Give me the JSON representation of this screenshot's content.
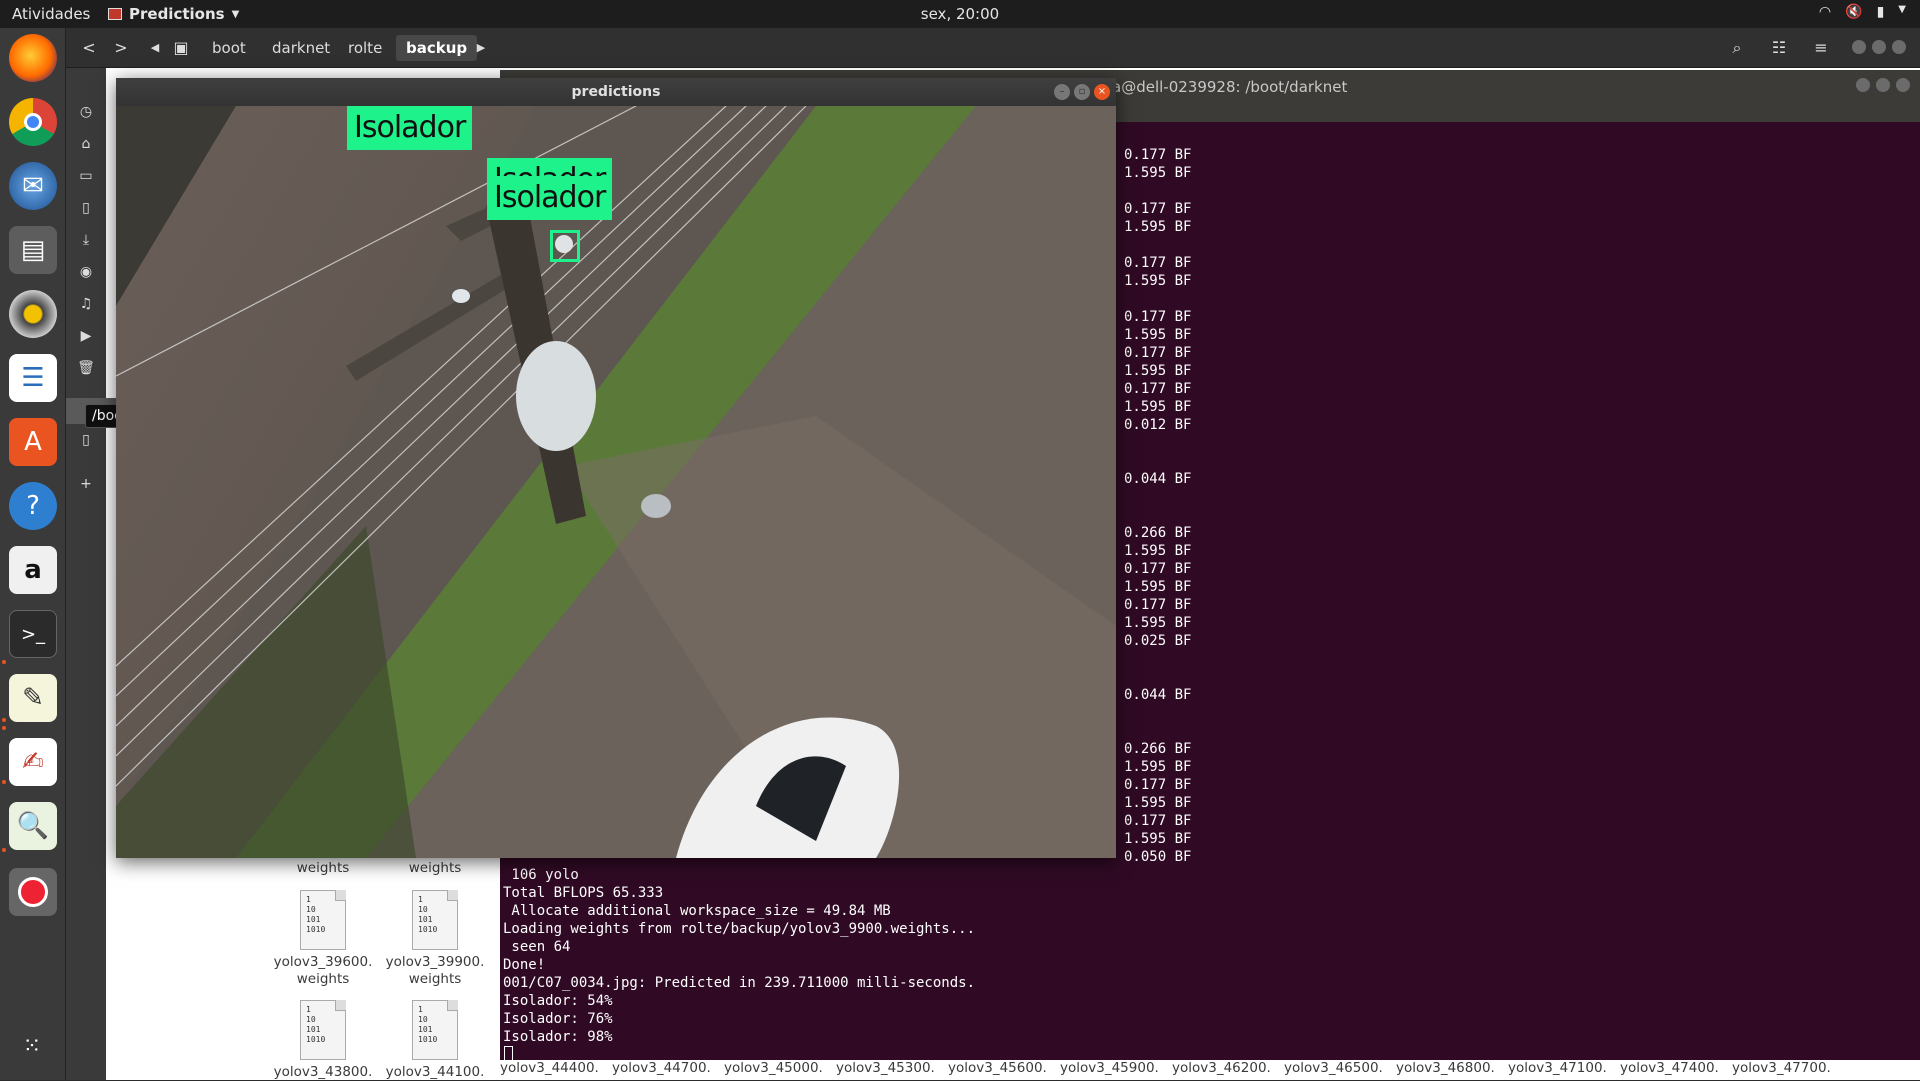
{
  "topbar": {
    "activities": "Atividades",
    "app_name": "Predictions",
    "clock": "sex, 20:00"
  },
  "dock": {
    "apps": [
      "firefox-icon",
      "chrome-icon",
      "thunderbird-icon",
      "files-icon",
      "rhythmbox-icon",
      "writer-icon",
      "software-icon",
      "help-icon",
      "amazon-icon",
      "terminal-icon",
      "gedit-icon",
      "evince-icon",
      "image-viewer-icon",
      "block-icon"
    ],
    "show_apps": "apps-grid-icon"
  },
  "files": {
    "breadcrumbs": [
      "boot",
      "darknet",
      "rolte",
      "backup"
    ],
    "active_crumb": "backup",
    "tooltip": "/boot/BBox-Label-Tool",
    "grid": [
      {
        "name1": "weights",
        "name2": ""
      },
      {
        "name1": "weights",
        "name2": ""
      },
      {
        "name1": "yolov3_39600.",
        "name2": "weights"
      },
      {
        "name1": "yolov3_39900.",
        "name2": "weights"
      },
      {
        "name1": "yolov3_43800.",
        "name2": ""
      },
      {
        "name1": "yolov3_44100.",
        "name2": ""
      }
    ],
    "doc_glyph": "1\n10\n101\n1010",
    "bottom_row": [
      "yolov3_44400.",
      "yolov3_44700.",
      "yolov3_45000.",
      "yolov3_45300.",
      "yolov3_45600.",
      "yolov3_45900.",
      "yolov3_46200.",
      "yolov3_46500.",
      "yolov3_46800.",
      "yolov3_47100.",
      "yolov3_47400.",
      "yolov3_47700."
    ]
  },
  "terminal": {
    "title": "a@dell-0239928: /boot/darknet",
    "bf_lines": "0.177 BF\n1.595 BF\n\n0.177 BF\n1.595 BF\n\n0.177 BF\n1.595 BF\n\n0.177 BF\n1.595 BF\n0.177 BF\n1.595 BF\n0.177 BF\n1.595 BF\n0.012 BF\n\n\n0.044 BF\n\n\n0.266 BF\n1.595 BF\n0.177 BF\n1.595 BF\n0.177 BF\n1.595 BF\n0.025 BF\n\n\n0.044 BF\n\n\n0.266 BF\n1.595 BF\n0.177 BF\n1.595 BF\n0.177 BF\n1.595 BF\n0.050 BF",
    "log_lines": " 106 yolo\nTotal BFLOPS 65.333\n Allocate additional workspace_size = 49.84 MB\nLoading weights from rolte/backup/yolov3_9900.weights...\n seen 64\nDone!\n001/C07_0034.jpg: Predicted in 239.711000 milli-seconds.\nIsolador: 54%\nIsolador: 76%\nIsolador: 98%"
  },
  "predictions": {
    "title": "predictions",
    "detections": [
      {
        "label": "Isolador",
        "confidence": "54%"
      },
      {
        "label": "Isolador",
        "confidence": "76%"
      },
      {
        "label": "Isolador",
        "confidence": "98%"
      }
    ]
  },
  "colors": {
    "detection": "#1ef28a",
    "terminal_bg": "#300a24",
    "accent": "#e95420"
  }
}
